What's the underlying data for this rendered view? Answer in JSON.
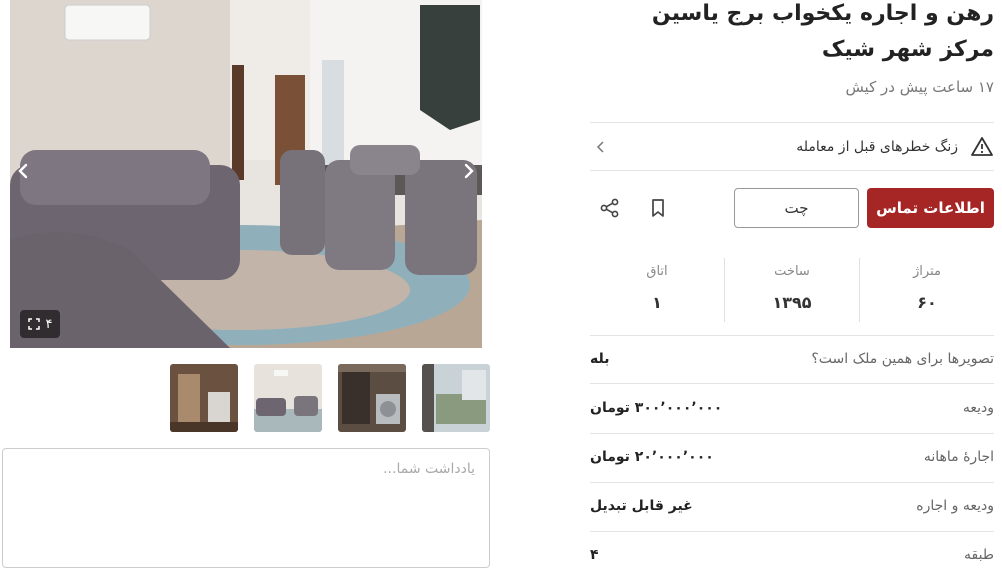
{
  "listing": {
    "title": "رهن و اجاره یکخواب برج یاسین مرکز شهر شیک",
    "subtitle": "۱۷ ساعت پیش در کیش"
  },
  "warning": {
    "label": "زنگ خطرهای قبل از معامله",
    "icon": "warning-triangle-icon"
  },
  "actions": {
    "contact_label": "اطلاعات تماس",
    "chat_label": "چت",
    "bookmark_icon": "bookmark-icon",
    "share_icon": "share-icon"
  },
  "stats": [
    {
      "label": "متراژ",
      "value": "۶۰"
    },
    {
      "label": "ساخت",
      "value": "۱۳۹۵"
    },
    {
      "label": "اتاق",
      "value": "۱"
    }
  ],
  "details": [
    {
      "key": "تصویرها برای همین ملک است؟",
      "value": "بله"
    },
    {
      "key": "ودیعه",
      "value": "۳۰۰٬۰۰۰٬۰۰۰ تومان"
    },
    {
      "key": "اجارهٔ ماهانه",
      "value": "۲۰٬۰۰۰٬۰۰۰ تومان"
    },
    {
      "key": "ودیعه و اجاره",
      "value": "غیر قابل تبدیل"
    },
    {
      "key": "طبقه",
      "value": "۴"
    }
  ],
  "gallery": {
    "count": "۴"
  },
  "note": {
    "placeholder": "یادداشت شما..."
  },
  "colors": {
    "accent": "#a62626"
  }
}
